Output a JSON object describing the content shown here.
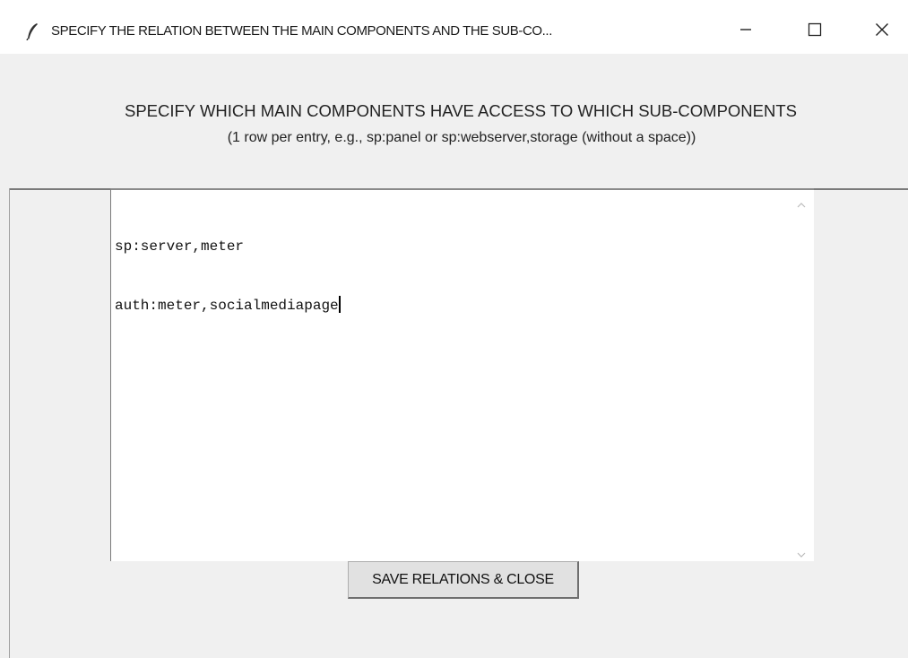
{
  "window": {
    "title": "SPECIFY THE RELATION BETWEEN THE MAIN COMPONENTS AND THE SUB-CO...",
    "icon": "feather-icon",
    "controls": {
      "minimize_icon": "minimize-icon",
      "maximize_icon": "maximize-icon",
      "close_icon": "close-icon"
    }
  },
  "instructions": {
    "heading": "SPECIFY WHICH MAIN COMPONENTS HAVE ACCESS TO WHICH SUB-COMPONENTS",
    "subheading": "(1 row per entry, e.g., sp:panel or sp:webserver,storage (without a space))"
  },
  "editor": {
    "lines": [
      "sp:server,meter",
      "auth:meter,socialmediapage"
    ]
  },
  "actions": {
    "save_label": "SAVE RELATIONS & CLOSE"
  },
  "colors": {
    "background": "#f0f0f0",
    "titlebar": "#ffffff",
    "text": "#222222"
  }
}
